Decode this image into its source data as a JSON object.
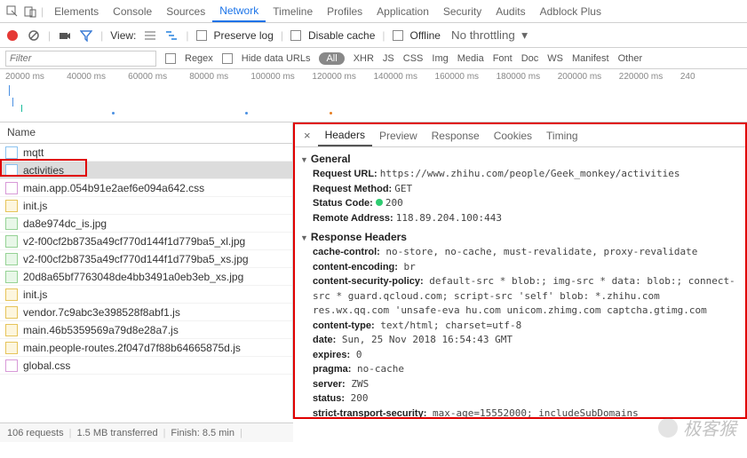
{
  "topTabs": [
    "Elements",
    "Console",
    "Sources",
    "Network",
    "Timeline",
    "Profiles",
    "Application",
    "Security",
    "Audits",
    "Adblock Plus"
  ],
  "topActive": 3,
  "toolbar": {
    "viewLabel": "View:",
    "preserveLog": "Preserve log",
    "disableCache": "Disable cache",
    "offline": "Offline",
    "throttling": "No throttling"
  },
  "filter": {
    "placeholder": "Filter",
    "regex": "Regex",
    "hideData": "Hide data URLs",
    "all": "All",
    "types": [
      "XHR",
      "JS",
      "CSS",
      "Img",
      "Media",
      "Font",
      "Doc",
      "WS",
      "Manifest",
      "Other"
    ]
  },
  "timeLabels": [
    "20000 ms",
    "40000 ms",
    "60000 ms",
    "80000 ms",
    "100000 ms",
    "120000 ms",
    "140000 ms",
    "160000 ms",
    "180000 ms",
    "200000 ms",
    "220000 ms",
    "240"
  ],
  "nameHeader": "Name",
  "requests": [
    {
      "name": "mqtt",
      "cls": "doc"
    },
    {
      "name": "activities",
      "cls": "doc",
      "sel": true
    },
    {
      "name": "main.app.054b91e2aef6e094a642.css",
      "cls": "css"
    },
    {
      "name": "init.js",
      "cls": "js"
    },
    {
      "name": "da8e974dc_is.jpg",
      "cls": "img"
    },
    {
      "name": "v2-f00cf2b8735a49cf770d144f1d779ba5_xl.jpg",
      "cls": "img"
    },
    {
      "name": "v2-f00cf2b8735a49cf770d144f1d779ba5_xs.jpg",
      "cls": "img"
    },
    {
      "name": "20d8a65bf7763048de4bb3491a0eb3eb_xs.jpg",
      "cls": "img"
    },
    {
      "name": "init.js",
      "cls": "js"
    },
    {
      "name": "vendor.7c9abc3e398528f8abf1.js",
      "cls": "js"
    },
    {
      "name": "main.46b5359569a79d8e28a7.js",
      "cls": "js"
    },
    {
      "name": "main.people-routes.2f047d7f88b64665875d.js",
      "cls": "js"
    },
    {
      "name": "global.css",
      "cls": "css"
    }
  ],
  "status": {
    "requests": "106 requests",
    "transferred": "1.5 MB transferred",
    "finish": "Finish: 8.5 min"
  },
  "detailTabs": [
    "Headers",
    "Preview",
    "Response",
    "Cookies",
    "Timing"
  ],
  "detailActive": 0,
  "general": {
    "title": "General",
    "url_l": "Request URL:",
    "url": "https://www.zhihu.com/people/Geek_monkey/activities",
    "method_l": "Request Method:",
    "method": "GET",
    "status_l": "Status Code:",
    "status": "200",
    "remote_l": "Remote Address:",
    "remote": "118.89.204.100:443"
  },
  "resp": {
    "title": "Response Headers",
    "rows": [
      {
        "k": "cache-control:",
        "v": "no-store, no-cache, must-revalidate, proxy-revalidate"
      },
      {
        "k": "content-encoding:",
        "v": "br"
      },
      {
        "k": "content-security-policy:",
        "v": "default-src * blob:; img-src * data: blob:; connect-src * guard.qcloud.com; script-src 'self' blob: *.zhihu.com res.wx.qq.com 'unsafe-eva hu.com unicom.zhimg.com captcha.gtimg.com"
      },
      {
        "k": "content-type:",
        "v": "text/html; charset=utf-8"
      },
      {
        "k": "date:",
        "v": "Sun, 25 Nov 2018 16:54:43 GMT"
      },
      {
        "k": "expires:",
        "v": "0"
      },
      {
        "k": "pragma:",
        "v": "no-cache"
      },
      {
        "k": "server:",
        "v": "ZWS"
      },
      {
        "k": "status:",
        "v": "200"
      },
      {
        "k": "strict-transport-security:",
        "v": "max-age=15552000; includeSubDomains"
      }
    ]
  },
  "watermark": "极客猴"
}
